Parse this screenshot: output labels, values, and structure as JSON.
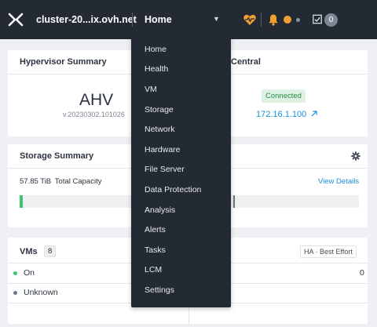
{
  "topbar": {
    "logo_icon": "nutanix-x-logo-icon",
    "cluster_name": "cluster-20...ix.ovh.net",
    "current_view": "Home",
    "view_chevron_icon": "chevron-down-icon",
    "health_icon": "heart-pulse-icon",
    "bell_icon": "bell-icon",
    "alert_color": "#f0a030",
    "tasks_icon": "task-checkbox-icon",
    "tasks_count": "0"
  },
  "hypervisor": {
    "title": "Hypervisor Summary",
    "name": "AHV",
    "version": "v.20230302.101026"
  },
  "prism_central": {
    "title": "Central",
    "status": "Connected",
    "ip": "172.16.1.100",
    "link_icon": "arrow-up-right-icon"
  },
  "storage": {
    "title": "Storage Summary",
    "capacity_value": "57.85",
    "capacity_unit": "TiB",
    "capacity_label": "Total Capacity",
    "view_details": "View Details",
    "settings_icon": "gear-icon",
    "used_fraction": 0.01,
    "threshold_fraction": 0.63,
    "accent": "#3fc476"
  },
  "vms": {
    "title": "VMs",
    "count": "8",
    "ha_badge": "HA · Best Effort",
    "rows": [
      {
        "label": "On",
        "value": "",
        "dot_color": "#3fc476"
      },
      {
        "label": "Unknown",
        "value": "",
        "dot_color": "#6b7a8c"
      }
    ],
    "right_value": "0"
  },
  "menu": {
    "items": [
      "Home",
      "Health",
      "VM",
      "Storage",
      "Network",
      "Hardware",
      "File Server",
      "Data Protection",
      "Analysis",
      "Alerts",
      "Tasks",
      "LCM",
      "Settings"
    ]
  }
}
